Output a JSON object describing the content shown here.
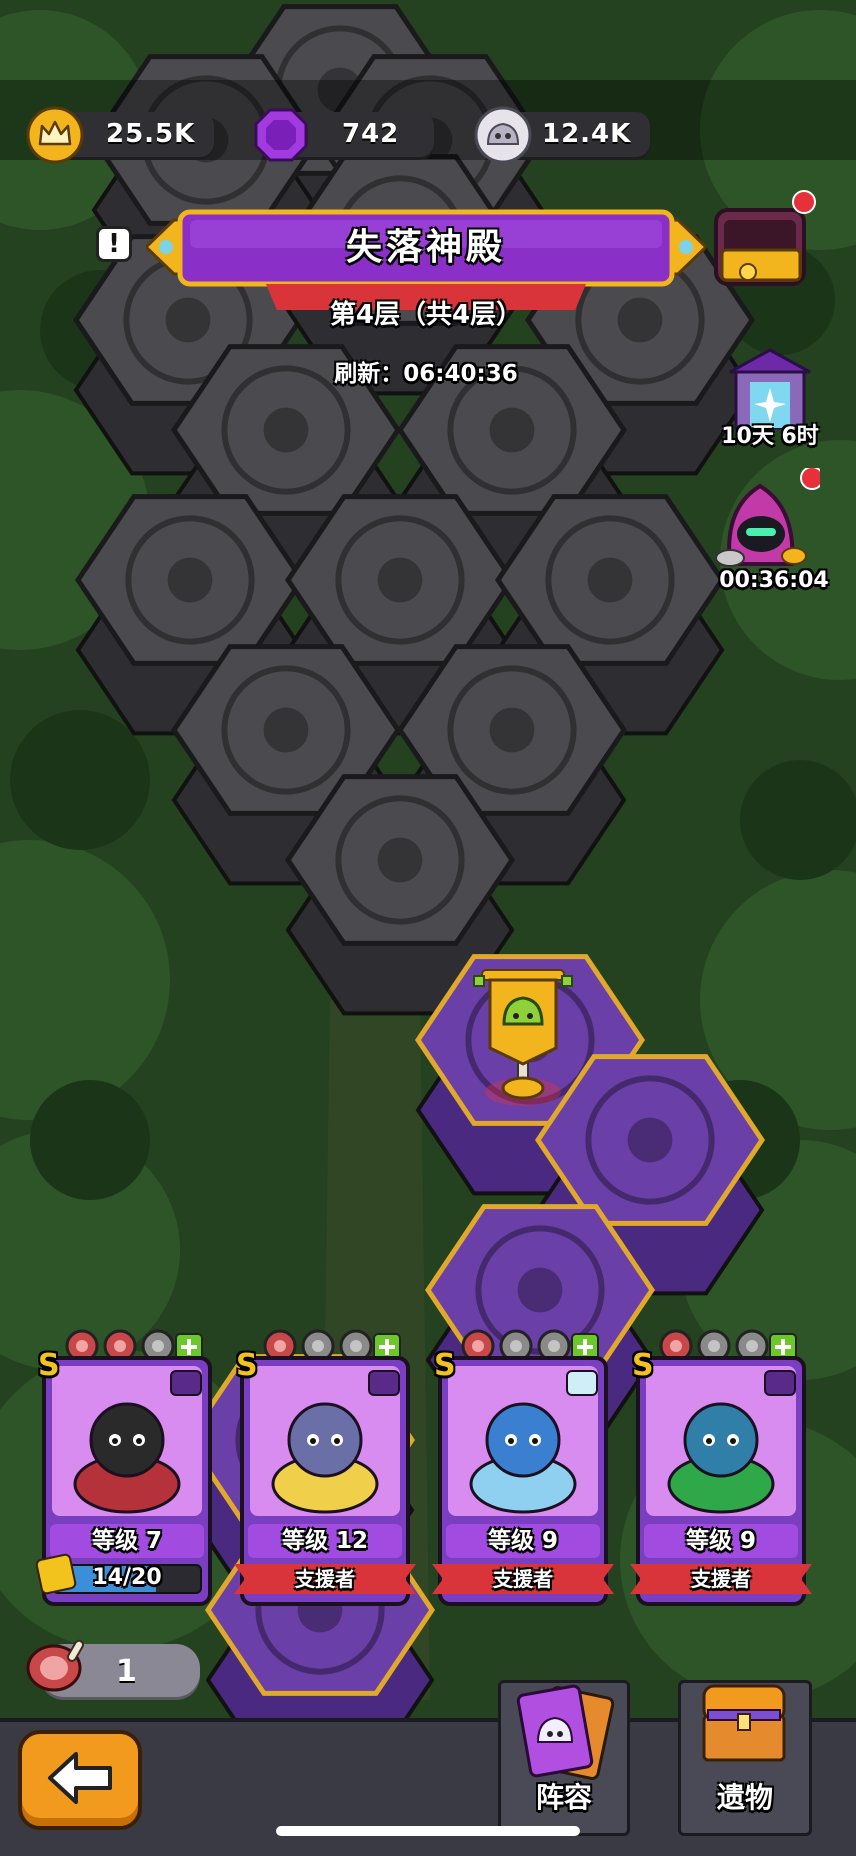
{
  "resources": {
    "crown": {
      "icon": "crown-icon",
      "value": "25.5K"
    },
    "gem": {
      "icon": "purple-gem-icon",
      "value": "742"
    },
    "slime": {
      "icon": "slime-token-icon",
      "value": "12.4K"
    }
  },
  "title_banner": {
    "title": "失落神殿",
    "floor": "第4层（共4层）",
    "refresh": "刷新：06:40:36",
    "alert_icon": "exclamation-icon"
  },
  "side_buttons": {
    "treasure": {
      "icon": "treasure-chest-icon"
    },
    "portal": {
      "icon": "portal-shrine-icon",
      "timer": "10天 6时"
    },
    "merchant": {
      "icon": "hooded-merchant-icon",
      "timer": "00:36:04"
    }
  },
  "heroes": [
    {
      "rank": "S",
      "name": "vampire-hero",
      "level": "等级 7",
      "progress": "14/20",
      "progress_fraction": 0.7,
      "meat": [
        "full",
        "full",
        "empty"
      ],
      "element": "bat-icon",
      "support": ""
    },
    {
      "rank": "S",
      "name": "armored-knight-hero",
      "level": "等级 12",
      "support": "支援者",
      "meat": [
        "full",
        "empty",
        "empty"
      ],
      "element": "bat-icon"
    },
    {
      "rank": "S",
      "name": "crystal-spider-hero",
      "level": "等级 9",
      "support": "支援者",
      "meat": [
        "full",
        "empty",
        "empty"
      ],
      "element": "water-drop-icon"
    },
    {
      "rank": "S",
      "name": "carnivorous-plant-hero",
      "level": "等级 9",
      "support": "支援者",
      "meat": [
        "full",
        "empty",
        "empty"
      ],
      "element": "sword-icon"
    }
  ],
  "meat_counter": {
    "icon": "meat-icon",
    "value": "1"
  },
  "bottom_bar": {
    "back_icon": "back-arrow-icon",
    "lineup_label": "阵容",
    "relics_label": "遗物"
  },
  "colors": {
    "purple": "#7b2fb8",
    "gold": "#f2b51d",
    "red_ribbon": "#d8343a",
    "forest": "#264a22"
  }
}
